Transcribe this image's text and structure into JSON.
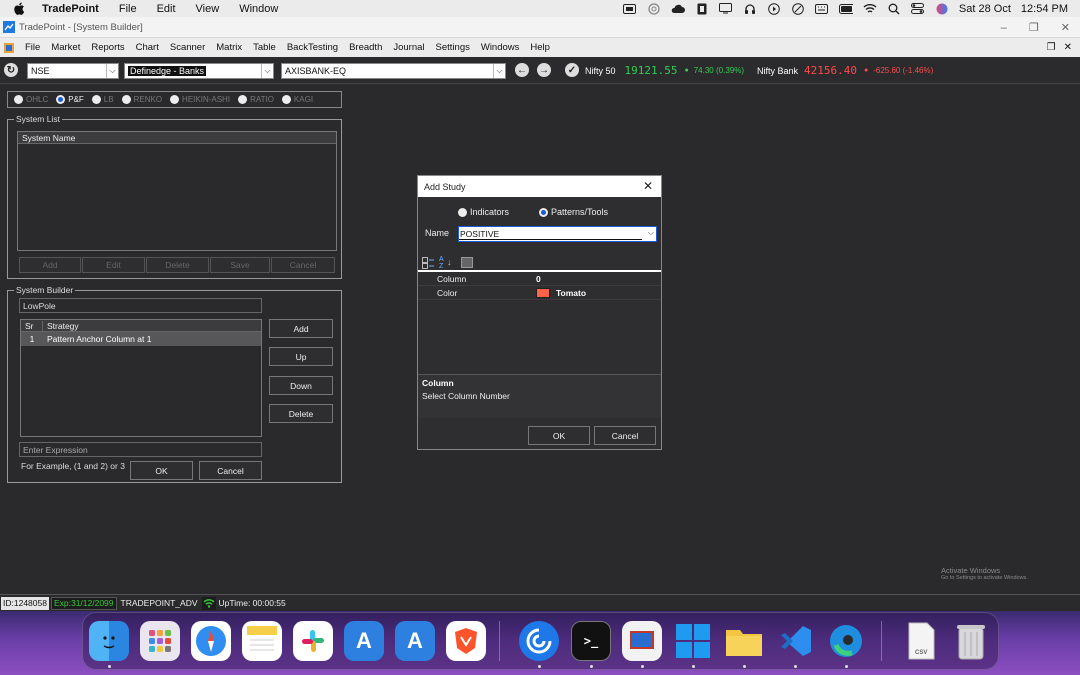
{
  "mac_menubar": {
    "app": "TradePoint",
    "menus": [
      "File",
      "Edit",
      "View",
      "Window"
    ],
    "date": "Sat 28 Oct",
    "time": "12:54 PM"
  },
  "window": {
    "title": "TradePoint - [System Builder]"
  },
  "app_menu": [
    "File",
    "Market",
    "Reports",
    "Chart",
    "Scanner",
    "Matrix",
    "Table",
    "BackTesting",
    "Breadth",
    "Journal",
    "Settings",
    "Windows",
    "Help"
  ],
  "toolbar": {
    "exchange": "NSE",
    "watchlist": "Definedge - Banks",
    "symbol": "AXISBANK-EQ",
    "tickers": [
      {
        "name": "Nifty 50",
        "value": "19121.55",
        "change": "74.30 (0.39%)",
        "dir": "up",
        "color": "#33cc55"
      },
      {
        "name": "Nifty Bank",
        "value": "42156.40",
        "change": "-625.60 (-1.46%)",
        "dir": "down",
        "color": "#ff4a4a"
      }
    ]
  },
  "chart_types": [
    {
      "label": "OHLC",
      "selected": false
    },
    {
      "label": "P&F",
      "selected": true
    },
    {
      "label": "LB",
      "selected": false
    },
    {
      "label": "RENKO",
      "selected": false
    },
    {
      "label": "HEIKIN-ASHI",
      "selected": false
    },
    {
      "label": "RATIO",
      "selected": false
    },
    {
      "label": "KAGI",
      "selected": false
    }
  ],
  "system_list": {
    "legend": "System List",
    "column": "System Name",
    "buttons": [
      "Add",
      "Edit",
      "Delete",
      "Save",
      "Cancel"
    ]
  },
  "system_builder": {
    "legend": "System Builder",
    "name_value": "LowPole",
    "col_sr": "Sr",
    "col_strategy": "Strategy",
    "rows": [
      {
        "sr": "1",
        "strategy": "Pattern Anchor Column at 1"
      }
    ],
    "side_buttons": [
      "Add",
      "Up",
      "Down",
      "Delete"
    ],
    "expression_placeholder": "Enter Expression",
    "example": "For Example, (1 and 2) or 3",
    "ok": "OK",
    "cancel": "Cancel"
  },
  "add_study": {
    "title": "Add Study",
    "opt_indicators": "Indicators",
    "opt_patterns": "Patterns/Tools",
    "name_label": "Name",
    "name_value": "POSITIVE",
    "properties": [
      {
        "label": "Column",
        "value": "0"
      },
      {
        "label": "Color",
        "value": "Tomato",
        "swatch": "#ff6347"
      }
    ],
    "help_title": "Column",
    "help_text": "Select Column Number",
    "ok": "OK",
    "cancel": "Cancel"
  },
  "watermark": {
    "line1": "Activate Windows",
    "line2": "Go to Settings to activate Windows."
  },
  "status_bar": {
    "id": "ID:1248058",
    "exp": "Exp:31/12/2099",
    "account": "TRADEPOINT_ADV",
    "uptime": "UpTime: 00:00:55"
  },
  "dock_apps": [
    "finder-icon",
    "launchpad-icon",
    "safari-icon",
    "notes-icon",
    "slack-icon",
    "xcode-icon",
    "simulator-icon",
    "brave-icon",
    "tradepoint-icon",
    "terminal-icon",
    "remote-desktop-icon",
    "windows-icon",
    "folder-icon",
    "vscode-icon",
    "edge-icon",
    "csv-file-icon",
    "trash-icon"
  ]
}
